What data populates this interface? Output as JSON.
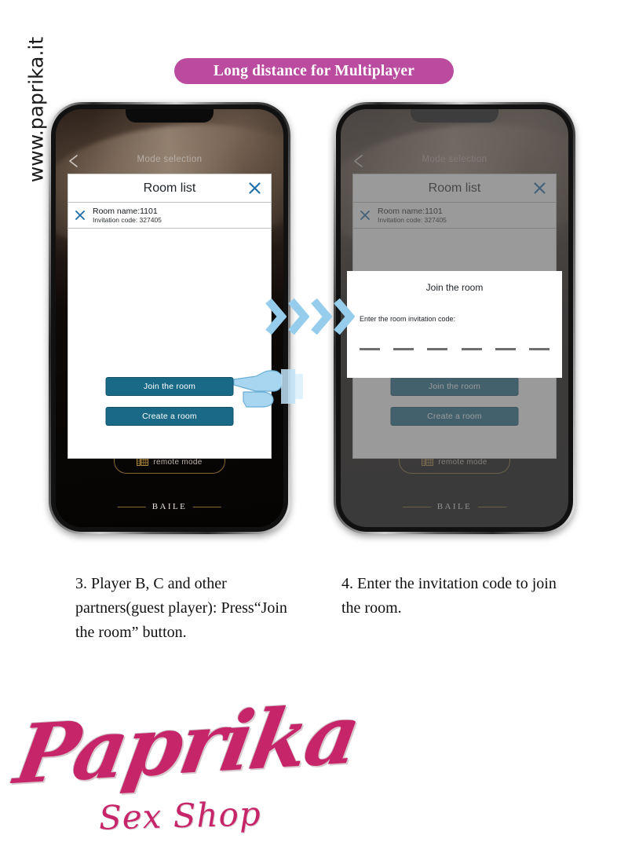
{
  "site": {
    "url": "www.paprika.it"
  },
  "banner": {
    "label": "Long distance for Multiplayer",
    "color": "#ba4b9f"
  },
  "theme": {
    "banner_pink": "#ba4b9f",
    "button_teal": "#1a6a87",
    "accent_blue": "#1f6fad",
    "arrow_blue": "#96cdec",
    "logo_pink": "#c7256a",
    "gold": "#8a6a33"
  },
  "phones": [
    {
      "id": "left",
      "app": {
        "back_icon": "back-arrow-icon",
        "title": "Mode selection",
        "remote_mode_label": "remote mode",
        "remote_mode_icon": "grid-keypad-icon",
        "brand": "BAILE"
      },
      "room_dialog": {
        "title": "Room list",
        "close_icon": "close-icon",
        "rows": [
          {
            "delete_icon": "close-icon",
            "name": "Room name:1101",
            "code": "Invitation code:  327405"
          }
        ]
      },
      "buttons": [
        {
          "name": "join-the-room-button",
          "label": "Join the room"
        },
        {
          "name": "create-a-room-button",
          "label": "Create a room"
        }
      ],
      "cursor": {
        "icon": "pointing-hand-icon",
        "target": "Join the room"
      },
      "dimmed": false,
      "join_dialog": null
    },
    {
      "id": "right",
      "app": {
        "back_icon": "back-arrow-icon",
        "title": "Mode selection",
        "remote_mode_label": "remote mode",
        "remote_mode_icon": "grid-keypad-icon",
        "brand": "BAILE"
      },
      "room_dialog": {
        "title": "Room list",
        "close_icon": "close-icon",
        "rows": [
          {
            "delete_icon": "close-icon",
            "name": "Room name:1101",
            "code": "Invitation code:  327405"
          }
        ]
      },
      "buttons": [
        {
          "name": "join-the-room-button",
          "label": "Join the room"
        },
        {
          "name": "create-a-room-button",
          "label": "Create a room"
        }
      ],
      "cursor": null,
      "dimmed": true,
      "join_dialog": {
        "title": "Join the room",
        "prompt": "Enter the room invitation code:",
        "code_slots": 6,
        "code_value": ""
      }
    }
  ],
  "arrows": {
    "count": 4,
    "direction": "right",
    "icon": "chevron-right-icon"
  },
  "captions": {
    "left": "3. Player B, C and other partners(guest player): Press“Join the room” button.",
    "right": "4. Enter the invitation code to join the room."
  },
  "logo": {
    "wordmark": "Paprika",
    "tagline": "Sex Shop"
  }
}
